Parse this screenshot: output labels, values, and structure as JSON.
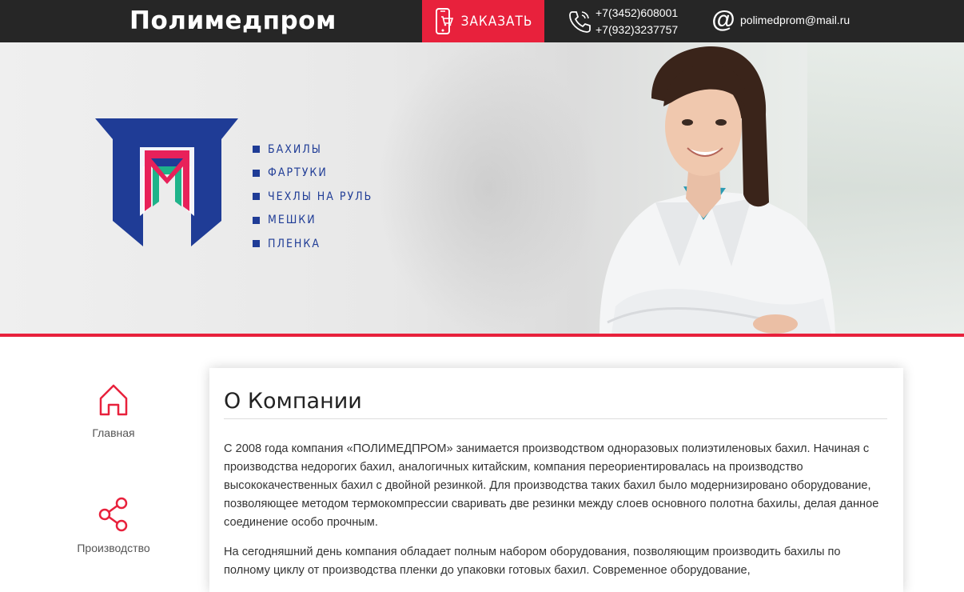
{
  "header": {
    "brand": "Полимедпром",
    "order_label": "ЗАКАЗАТЬ",
    "phone_1": "+7(3452)608001",
    "phone_2": "+7(932)3237757",
    "email": "polimedprom@mail.ru"
  },
  "hero": {
    "logo_letters": "МП",
    "menu": [
      {
        "label": "БАХИЛЫ"
      },
      {
        "label": "ФАРТУКИ"
      },
      {
        "label": "ЧЕХЛЫ НА РУЛЬ"
      },
      {
        "label": "МЕШКИ"
      },
      {
        "label": "ПЛЕНКА"
      }
    ]
  },
  "sidebar": {
    "items": [
      {
        "label": "Главная",
        "icon": "home-icon"
      },
      {
        "label": "Производство",
        "icon": "share-icon"
      }
    ]
  },
  "about": {
    "title": "О Компании",
    "p1": "С 2008 года компания «ПОЛИМЕДПРОМ» занимается производством одноразовых полиэтиленовых бахил. Начиная с производства недорогих бахил, аналогичных китайским, компания переориентировалась на производство высококачественных бахил с двойной резинкой. Для производства таких бахил было модернизировано оборудование, позволяющее методом термокомпрессии сваривать две резинки между слоев основного полотна бахилы, делая данное соединение особо прочным.",
    "p2": "На сегодняшний день компания обладает полным набором оборудования, позволяющим производить бахилы по полному циклу от производства пленки до упаковки готовых бахил. Современное оборудование,"
  },
  "colors": {
    "accent": "#e8213c",
    "brand_blue": "#1f3c96",
    "topbar": "#262626"
  }
}
